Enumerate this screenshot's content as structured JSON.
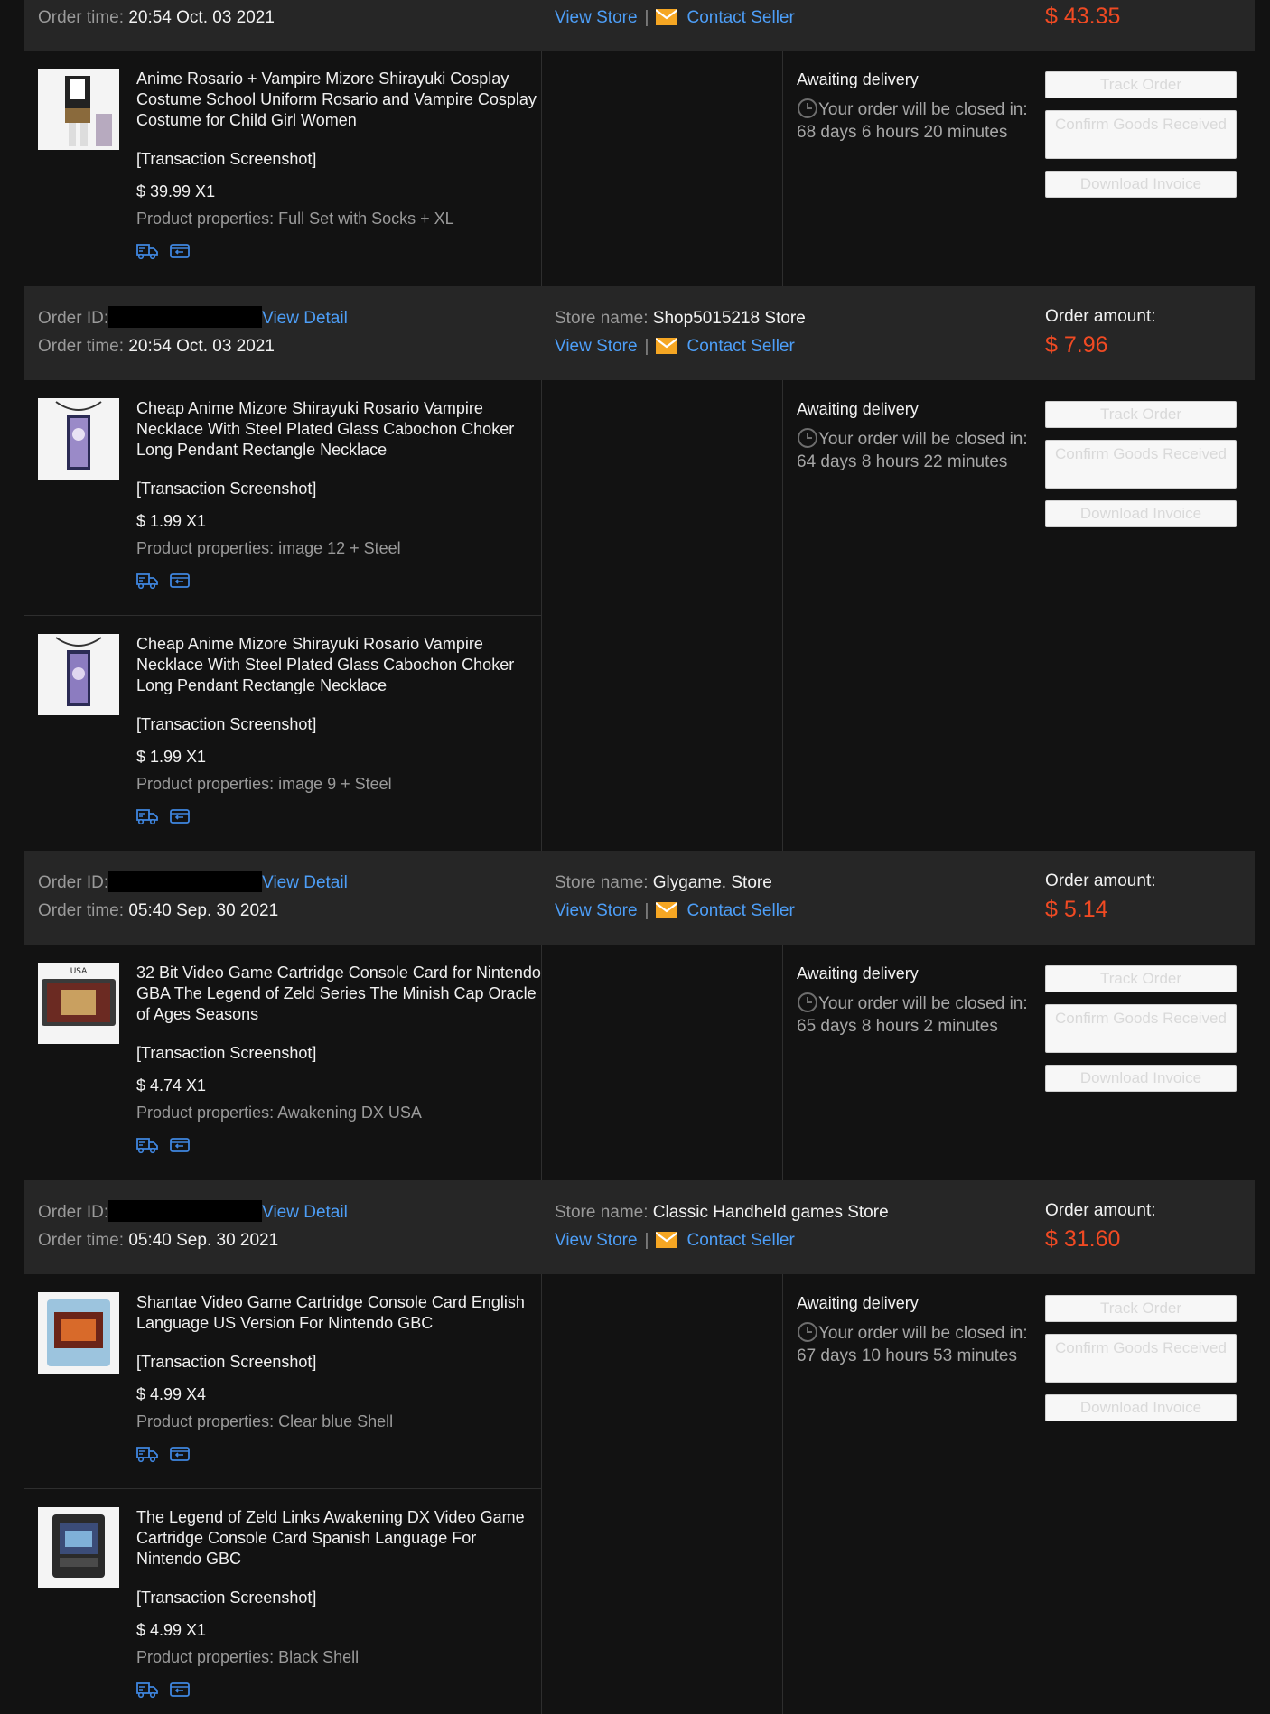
{
  "labels": {
    "order_id": "Order ID:",
    "order_time": "Order time:",
    "view_detail": "View Detail",
    "store_name": "Store name:",
    "view_store": "View Store",
    "contact_seller": "Contact Seller",
    "order_amount": "Order amount:",
    "separator": "|",
    "transaction_screenshot": "[Transaction Screenshot]",
    "product_properties": "Product properties:",
    "awaiting_delivery": "Awaiting delivery",
    "track_order": "Track Order",
    "confirm_goods": "Confirm Goods Received",
    "download_invoice": "Download Invoice"
  },
  "colors": {
    "accent_link": "#4d9ef7",
    "price_red": "#f04a23",
    "header_bg": "#262626",
    "page_bg": "#121212"
  },
  "icons": [
    "truck-icon",
    "return-box-icon",
    "envelope-icon",
    "clock-icon"
  ],
  "orders": [
    {
      "order_time": "20:54 Oct. 03 2021",
      "amount": "$ 43.35",
      "status": "Awaiting delivery",
      "status_detail": "Your order will be closed in: 68 days 6 hours 20 minutes",
      "items": [
        {
          "title": "Anime Rosario + Vampire Mizore Shirayuki Cosplay Costume School Uniform Rosario and Vampire Cosplay Costume for Child Girl Women",
          "price_qty": "$ 39.99 X1",
          "props": "Full Set with Socks + XL"
        }
      ]
    },
    {
      "order_time": "20:54 Oct. 03 2021",
      "store": "Shop5015218 Store",
      "amount": "$ 7.96",
      "status": "Awaiting delivery",
      "status_detail": "Your order will be closed in: 64 days 8 hours 22 minutes",
      "items": [
        {
          "title": "Cheap Anime Mizore Shirayuki Rosario Vampire Necklace With Steel Plated Glass Cabochon Choker Long Pendant Rectangle Necklace",
          "price_qty": "$ 1.99 X1",
          "props": "image 12 + Steel"
        },
        {
          "title": "Cheap Anime Mizore Shirayuki Rosario Vampire Necklace With Steel Plated Glass Cabochon Choker Long Pendant Rectangle Necklace",
          "price_qty": "$ 1.99 X1",
          "props": "image 9 + Steel"
        }
      ]
    },
    {
      "order_time": "05:40 Sep. 30 2021",
      "store": "Glygame. Store",
      "amount": "$ 5.14",
      "status": "Awaiting delivery",
      "status_detail": "Your order will be closed in: 65 days 8 hours 2 minutes",
      "items": [
        {
          "title": "32 Bit Video Game Cartridge Console Card for Nintendo GBA The Legend of Zeld Series The Minish Cap Oracle of Ages Seasons",
          "price_qty": "$ 4.74 X1",
          "props": "Awakening DX USA"
        }
      ]
    },
    {
      "order_time": "05:40 Sep. 30 2021",
      "store": "Classic Handheld games Store",
      "amount": "$ 31.60",
      "status": "Awaiting delivery",
      "status_detail": "Your order will be closed in: 67 days 10 hours 53 minutes",
      "items": [
        {
          "title": "Shantae Video Game Cartridge Console Card English Language US Version For Nintendo GBC",
          "price_qty": "$ 4.99 X4",
          "props": "Clear blue Shell"
        },
        {
          "title": "The Legend of Zeld Links Awakening DX Video Game Cartridge Console Card Spanish Language For Nintendo GBC",
          "price_qty": "$ 4.99 X1",
          "props": "Black Shell"
        }
      ]
    }
  ]
}
